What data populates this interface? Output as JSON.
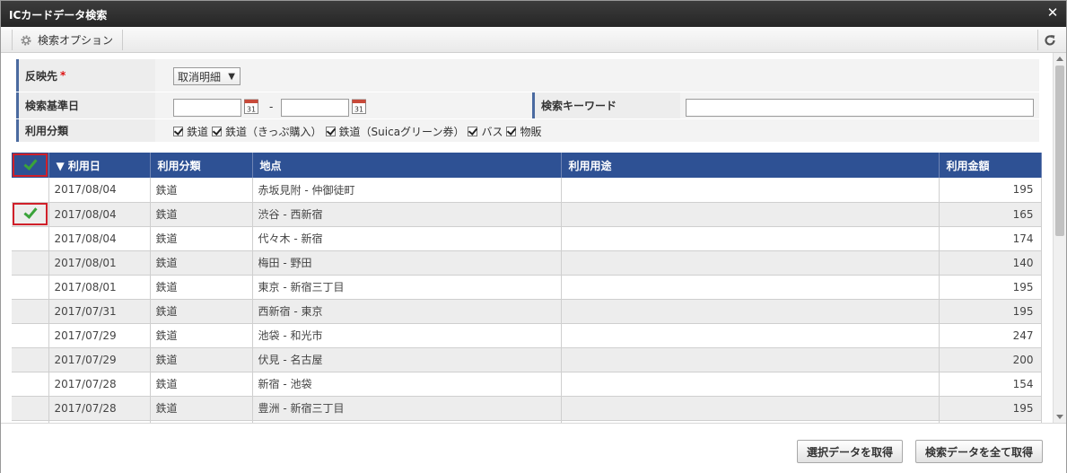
{
  "window": {
    "title": "ICカードデータ検索"
  },
  "toolbar": {
    "search_options_label": "検索オプション"
  },
  "form": {
    "target_label": "反映先",
    "required_mark": "*",
    "target_value": "取消明細",
    "base_date_label": "検索基準日",
    "date_separator": "-",
    "keyword_label": "検索キーワード",
    "usage_type_label": "利用分類",
    "usage_types": [
      "鉄道",
      "鉄道（きっぷ購入）",
      "鉄道（Suicaグリーン券）",
      "バス",
      "物販"
    ]
  },
  "table": {
    "sort_indicator": "▼",
    "headers": [
      "利用日",
      "利用分類",
      "地点",
      "利用用途",
      "利用金額"
    ],
    "rows": [
      {
        "date": "2017/08/04",
        "type": "鉄道",
        "place": "赤坂見附 - 仲御徒町",
        "purpose": "",
        "amount": "195",
        "checked": false
      },
      {
        "date": "2017/08/04",
        "type": "鉄道",
        "place": "渋谷 - 西新宿",
        "purpose": "",
        "amount": "165",
        "checked": true
      },
      {
        "date": "2017/08/04",
        "type": "鉄道",
        "place": "代々木 - 新宿",
        "purpose": "",
        "amount": "174",
        "checked": false
      },
      {
        "date": "2017/08/01",
        "type": "鉄道",
        "place": "梅田 - 野田",
        "purpose": "",
        "amount": "140",
        "checked": false
      },
      {
        "date": "2017/08/01",
        "type": "鉄道",
        "place": "東京 - 新宿三丁目",
        "purpose": "",
        "amount": "195",
        "checked": false
      },
      {
        "date": "2017/07/31",
        "type": "鉄道",
        "place": "西新宿 - 東京",
        "purpose": "",
        "amount": "195",
        "checked": false
      },
      {
        "date": "2017/07/29",
        "type": "鉄道",
        "place": "池袋 - 和光市",
        "purpose": "",
        "amount": "247",
        "checked": false
      },
      {
        "date": "2017/07/29",
        "type": "鉄道",
        "place": "伏見 - 名古屋",
        "purpose": "",
        "amount": "200",
        "checked": false
      },
      {
        "date": "2017/07/28",
        "type": "鉄道",
        "place": "新宿 - 池袋",
        "purpose": "",
        "amount": "154",
        "checked": false
      },
      {
        "date": "2017/07/28",
        "type": "鉄道",
        "place": "豊洲 - 新宿三丁目",
        "purpose": "",
        "amount": "195",
        "checked": false
      },
      {
        "date": "",
        "type": "",
        "place": "",
        "purpose": "",
        "amount": "",
        "checked": false
      }
    ]
  },
  "footer": {
    "get_selected_label": "選択データを取得",
    "get_all_label": "検索データを全て取得"
  },
  "colors": {
    "header_blue": "#2e5194",
    "check_green": "#3aa33a",
    "highlight_red": "#d0202a"
  }
}
